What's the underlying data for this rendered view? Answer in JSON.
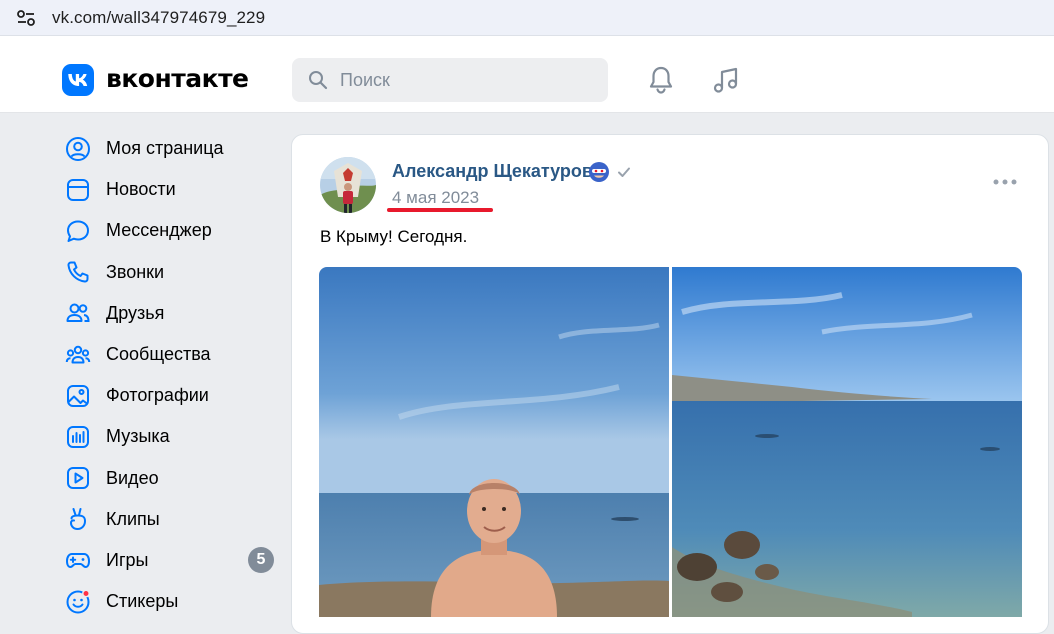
{
  "browser": {
    "url": "vk.com/wall347974679_229"
  },
  "header": {
    "logo_text": "вконтакте",
    "search": {
      "placeholder": "Поиск",
      "value": ""
    },
    "icons": [
      "bell-icon",
      "music-icon"
    ]
  },
  "sidebar": {
    "items": [
      {
        "label": "Моя страница",
        "icon": "user-circle-icon"
      },
      {
        "label": "Новости",
        "icon": "news-icon"
      },
      {
        "label": "Мессенджер",
        "icon": "message-icon"
      },
      {
        "label": "Звонки",
        "icon": "phone-icon"
      },
      {
        "label": "Друзья",
        "icon": "friends-icon"
      },
      {
        "label": "Сообщества",
        "icon": "communities-icon"
      },
      {
        "label": "Фотографии",
        "icon": "photos-icon"
      },
      {
        "label": "Музыка",
        "icon": "music-wave-icon"
      },
      {
        "label": "Видео",
        "icon": "video-icon"
      },
      {
        "label": "Клипы",
        "icon": "clips-icon"
      },
      {
        "label": "Игры",
        "icon": "gamepad-icon",
        "badge": "5"
      },
      {
        "label": "Стикеры",
        "icon": "stickers-icon"
      }
    ]
  },
  "post": {
    "author": "Александр Щекатуров",
    "date": "4 мая 2023",
    "text": "В Крыму! Сегодня.",
    "photos": [
      "beach-selfie-photo",
      "sea-coast-photo"
    ]
  },
  "colors": {
    "accent": "#0077ff",
    "link": "#2a5885",
    "secondary_text": "#818c99",
    "annotation_underline": "#e8192c",
    "background": "#ebedf0"
  }
}
